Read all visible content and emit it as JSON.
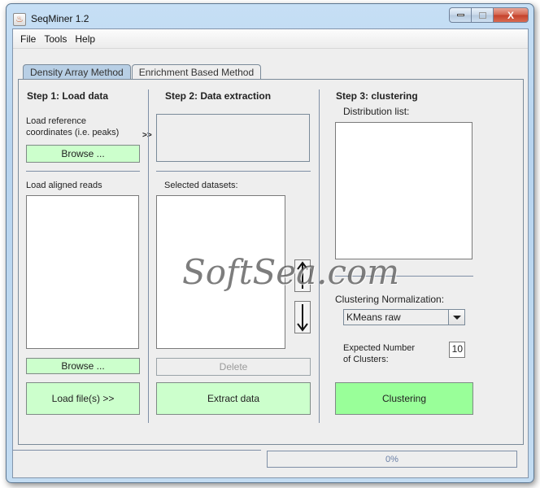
{
  "window": {
    "title": "SeqMiner 1.2",
    "controls": {
      "minimize": "minimize",
      "maximize": "maximize",
      "close": "X"
    }
  },
  "menu": [
    "File",
    "Tools",
    "Help"
  ],
  "tabs": [
    {
      "label": "Density Array Method",
      "active": true
    },
    {
      "label": "Enrichment Based Method",
      "active": false
    }
  ],
  "step1": {
    "title": "Step 1: Load data",
    "ref_label_line1": "Load reference",
    "ref_label_line2": "coordinates (i.e. peaks)",
    "browse_ref": "Browse ...",
    "arrow": ">>",
    "reads_label": "Load aligned reads",
    "browse_reads": "Browse ...",
    "load_files": "Load file(s)  >>"
  },
  "step2": {
    "title": "Step 2: Data extraction",
    "selected_label": "Selected datasets:",
    "delete": "Delete",
    "extract": "Extract data",
    "up_icon": "↑",
    "down_icon": "↓"
  },
  "step3": {
    "title": "Step 3: clustering",
    "distribution_label": "Distribution list:",
    "normalization_label": "Clustering Normalization:",
    "normalization_value": "KMeans raw",
    "clusters_label_line1": "Expected Number",
    "clusters_label_line2": "of Clusters:",
    "clusters_value": "10",
    "clustering_button": "Clustering"
  },
  "status": {
    "progress_text": "0%",
    "progress_value": 0
  },
  "watermark": "SoftSea.com"
}
